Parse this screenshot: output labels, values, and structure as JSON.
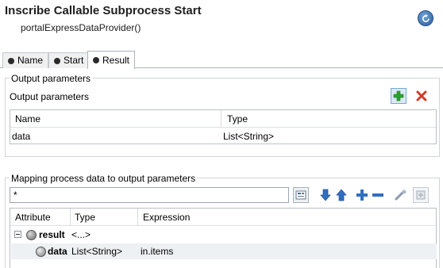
{
  "header": {
    "title": "Inscribe Callable Subprocess Start",
    "subtitle": "portalExpressDataProvider()",
    "refresh_icon": "refresh-icon"
  },
  "tabs": [
    {
      "label": "Name",
      "active": false
    },
    {
      "label": "Start",
      "active": false
    },
    {
      "label": "Result",
      "active": true
    }
  ],
  "output_section": {
    "group_label": "Output parameters",
    "table_label": "Output parameters",
    "add_icon": "add-icon",
    "remove_icon": "remove-icon",
    "columns": [
      "Name",
      "Type"
    ],
    "rows": [
      {
        "name": "data",
        "type": "List<String>"
      }
    ]
  },
  "mapping_section": {
    "group_label": "Mapping process data to output parameters",
    "filter_value": "*",
    "columns": [
      "Attribute",
      "Type",
      "Expression"
    ],
    "rows": [
      {
        "attribute": "result",
        "type": "<...>",
        "expression": ""
      },
      {
        "attribute": "data",
        "type": "List<String>",
        "expression": "in.items"
      }
    ]
  },
  "colors": {
    "accent": "#2c5f9e",
    "add_green": "#2fa52f",
    "remove_red": "#d23a2a",
    "arrow_blue": "#2f6fc0"
  }
}
